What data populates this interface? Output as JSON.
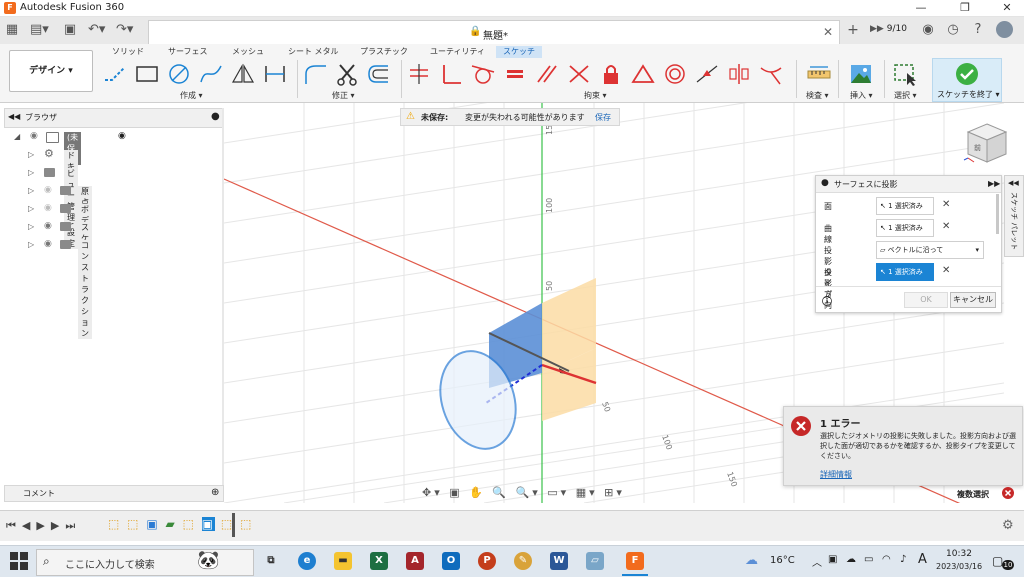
{
  "window": {
    "app_title": "Autodesk Fusion 360",
    "logo": "F",
    "minimize": "—",
    "maximize": "❐",
    "close": "✕"
  },
  "appbar": {
    "doc_name": "無題*",
    "jobs": "9/10",
    "add_tab": "+"
  },
  "ribbon": {
    "tabs": [
      "ソリッド",
      "サーフェス",
      "メッシュ",
      "シート メタル",
      "プラスチック",
      "ユーティリティ",
      "スケッチ"
    ],
    "active_tab": "スケッチ",
    "workspace": "デザイン ▾",
    "groups": {
      "create": "作成 ▾",
      "modify": "修正 ▾",
      "constraints": "拘束 ▾",
      "inspect": "検査 ▾",
      "insert": "挿入 ▾",
      "select": "選択 ▾",
      "finish": "スケッチを終了 ▾"
    }
  },
  "browser": {
    "title": "ブラウザ",
    "items": [
      {
        "label": "(未保存)"
      },
      {
        "label": "ドキュメントの設定"
      },
      {
        "label": "ビュー管理"
      },
      {
        "label": "原点"
      },
      {
        "label": "ボディ"
      },
      {
        "label": "スケッチ"
      },
      {
        "label": "コンストラクション"
      }
    ]
  },
  "unsaved": {
    "label": "未保存:",
    "message": "変更が失われる可能性があります",
    "save": "保存"
  },
  "viewcube": {
    "label": "前"
  },
  "axis_labels": {
    "y150": "150",
    "y100": "100",
    "y50": "50",
    "x50": "50",
    "x100": "100",
    "x150": "150"
  },
  "panel": {
    "title": "サーフェスに投影",
    "rows": [
      {
        "label": "面",
        "value": "1 選択済み"
      },
      {
        "label": "曲線",
        "value": "1 選択済み"
      },
      {
        "label": "投影タイプ",
        "value": "ベクトルに沿って"
      },
      {
        "label": "投影方向",
        "value": "1 選択済み"
      }
    ],
    "ok": "OK",
    "cancel": "キャンセル"
  },
  "palette_tab": "スケッチ パレット",
  "error": {
    "title": "1 エラー",
    "message": "選択したジオメトリの投影に失敗しました。投影方向および選択した面が適切であるかを確認するか、投影タイプを変更してください。",
    "link": "詳細情報"
  },
  "multi_select": "複数選択",
  "comments": "コメント",
  "taskbar": {
    "search_placeholder": "ここに入力して検索",
    "weather": "16°C",
    "time": "10:32",
    "date": "2023/03/16",
    "ime": "A",
    "notifications": "10"
  },
  "colors": {
    "accent": "#1b84d4",
    "error": "#c62828",
    "finish_check": "#3cb043"
  }
}
